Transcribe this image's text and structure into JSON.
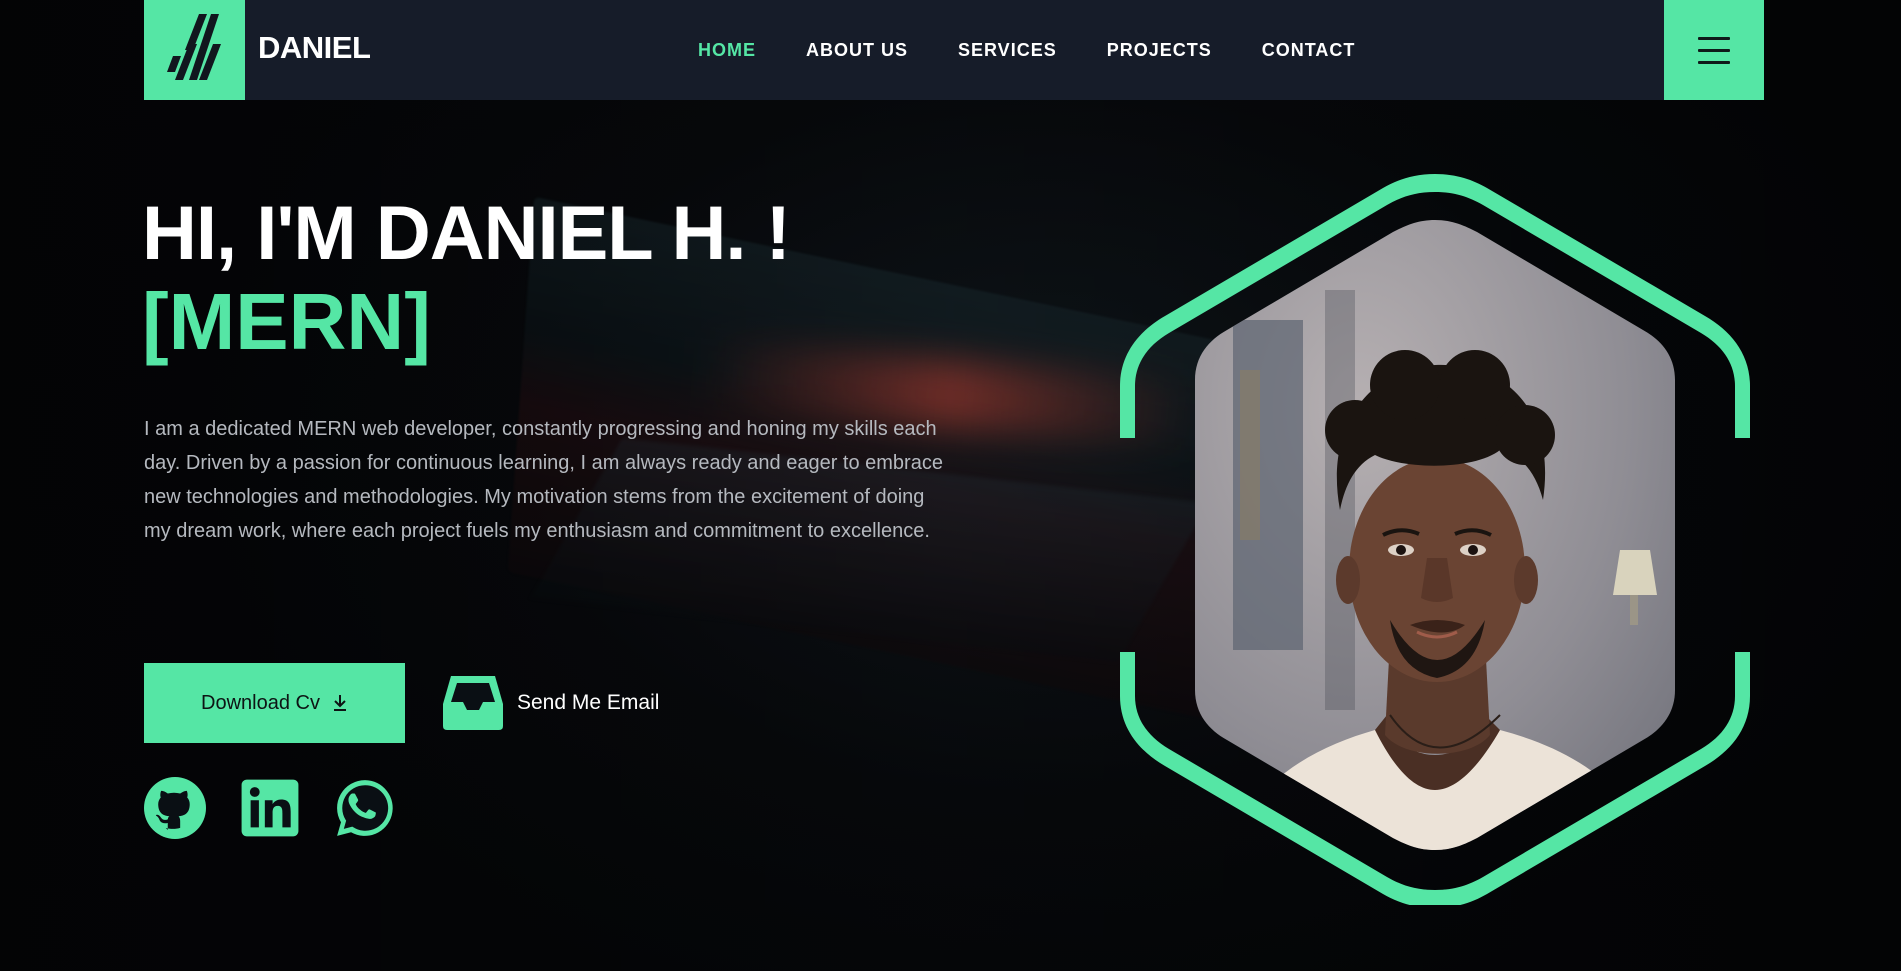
{
  "brand": {
    "name": "DANIEL",
    "logo": "slashes-logo-icon"
  },
  "nav": {
    "items": [
      {
        "label": "HOME",
        "active": true
      },
      {
        "label": "ABOUT US",
        "active": false
      },
      {
        "label": "SERVICES",
        "active": false
      },
      {
        "label": "PROJECTS",
        "active": false
      },
      {
        "label": "CONTACT",
        "active": false
      }
    ],
    "menu_icon": "hamburger-menu-icon"
  },
  "hero": {
    "title": "HI, I'M DANIEL H. !",
    "subtitle": "[MERN]",
    "description": "I am a dedicated MERN web developer, constantly progressing and honing my skills each day. Driven by a passion for continuous learning, I am always ready and eager to embrace new technologies and methodologies. My motivation stems from the excitement of doing my dream work, where each project fuels my enthusiasm and commitment to excellence.",
    "download_label": "Download Cv",
    "email_label": "Send Me Email"
  },
  "socials": [
    {
      "name": "github-icon"
    },
    {
      "name": "linkedin-icon"
    },
    {
      "name": "whatsapp-icon"
    }
  ],
  "colors": {
    "accent": "#55e6a5",
    "header_bg": "#161c29",
    "page_bg": "#06080b",
    "text_muted": "#b5b9bf"
  }
}
